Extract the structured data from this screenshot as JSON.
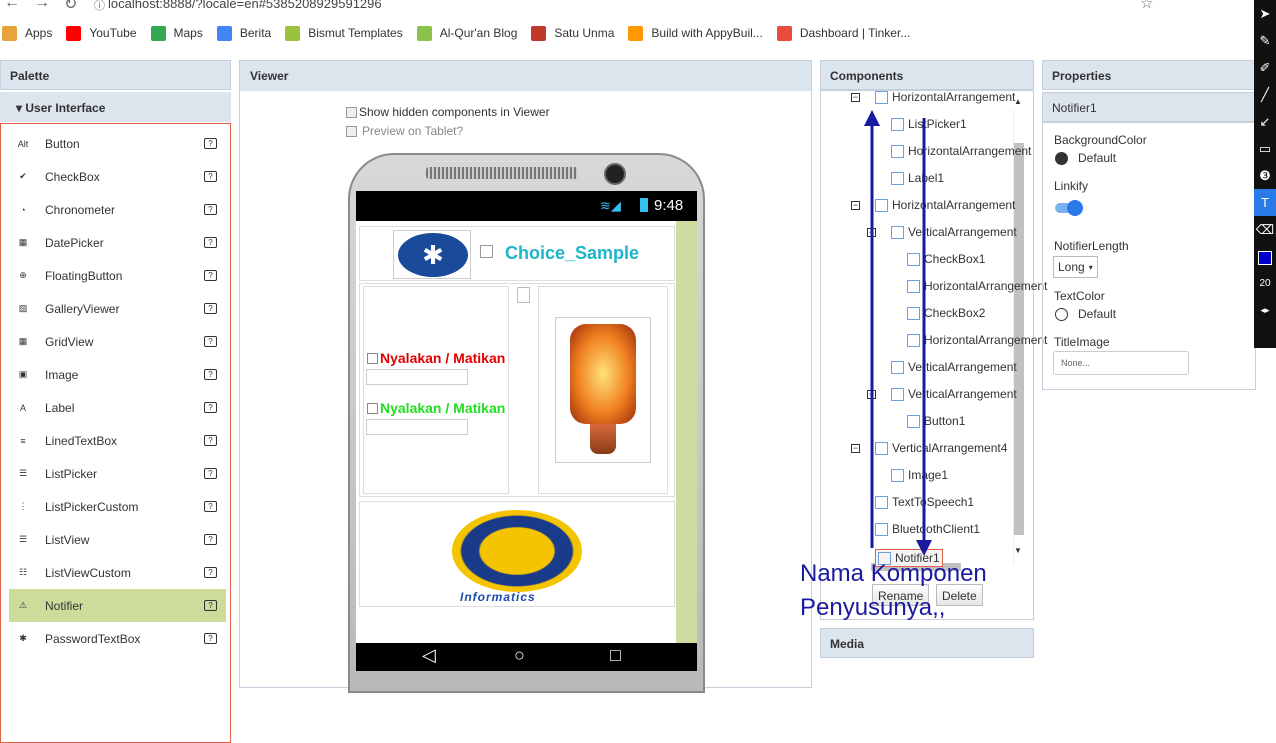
{
  "browser": {
    "url": "localhost:8888/?locale=en#5385208929591296",
    "bookmarks": [
      "Apps",
      "YouTube",
      "Maps",
      "Berita",
      "Bismut Templates",
      "Al-Qur'an Blog",
      "Satu Unma",
      "Build with AppyBuil...",
      "Dashboard | Tinker..."
    ],
    "bookmark_colors": [
      "#e8a33b",
      "#ff0000",
      "#34a853",
      "#4285f4",
      "#9bc23c",
      "#8bc34a",
      "#c0392b",
      "#ff9800",
      "#e74c3c"
    ]
  },
  "palette": {
    "title": "Palette",
    "section": "User Interface",
    "items": [
      {
        "label": "Button",
        "icon": "button-icon"
      },
      {
        "label": "CheckBox",
        "icon": "checkbox-icon"
      },
      {
        "label": "Chronometer",
        "icon": "chronometer-icon"
      },
      {
        "label": "DatePicker",
        "icon": "datepicker-icon"
      },
      {
        "label": "FloatingButton",
        "icon": "floating-button-icon"
      },
      {
        "label": "GalleryViewer",
        "icon": "gallery-viewer-icon"
      },
      {
        "label": "GridView",
        "icon": "grid-view-icon"
      },
      {
        "label": "Image",
        "icon": "image-icon"
      },
      {
        "label": "Label",
        "icon": "label-icon"
      },
      {
        "label": "LinedTextBox",
        "icon": "lined-textbox-icon"
      },
      {
        "label": "ListPicker",
        "icon": "listpicker-icon"
      },
      {
        "label": "ListPickerCustom",
        "icon": "listpicker-custom-icon"
      },
      {
        "label": "ListView",
        "icon": "listview-icon"
      },
      {
        "label": "ListViewCustom",
        "icon": "listview-custom-icon"
      },
      {
        "label": "Notifier",
        "icon": "notifier-icon",
        "selected": true
      },
      {
        "label": "PasswordTextBox",
        "icon": "password-icon"
      }
    ]
  },
  "viewer": {
    "title": "Viewer",
    "show_hidden": "Show hidden components in Viewer",
    "preview_tablet": "Preview on Tablet?",
    "status_time": "9:48",
    "app_title": "Choice_Sample",
    "checkbox_red": "Nyalakan / Matikan",
    "checkbox_green": "Nyalakan / Matikan",
    "logo_caption": "Informatics",
    "colors": {
      "red": "#e00000",
      "green": "#22dd22",
      "title": "#1db5c8",
      "sidebar": "#cfdca0"
    }
  },
  "components": {
    "title": "Components",
    "nodes": [
      {
        "label": "HorizontalArrangement",
        "indent": 1
      },
      {
        "label": "ListPicker1",
        "indent": 2
      },
      {
        "label": "HorizontalArrangement",
        "indent": 2
      },
      {
        "label": "Label1",
        "indent": 2
      },
      {
        "label": "HorizontalArrangement",
        "indent": 1
      },
      {
        "label": "VerticalArrangement",
        "indent": 2
      },
      {
        "label": "CheckBox1",
        "indent": 3
      },
      {
        "label": "HorizontalArrangement",
        "indent": 3
      },
      {
        "label": "CheckBox2",
        "indent": 3
      },
      {
        "label": "HorizontalArrangement",
        "indent": 3
      },
      {
        "label": "VerticalArrangement",
        "indent": 2
      },
      {
        "label": "VerticalArrangement",
        "indent": 2
      },
      {
        "label": "Button1",
        "indent": 3
      },
      {
        "label": "VerticalArrangement4",
        "indent": 1
      },
      {
        "label": "Image1",
        "indent": 2
      },
      {
        "label": "TextToSpeech1",
        "indent": 1
      },
      {
        "label": "BluetoothClient1",
        "indent": 1
      },
      {
        "label": "Notifier1",
        "indent": 1
      }
    ],
    "rename": "Rename",
    "delete": "Delete",
    "media_title": "Media"
  },
  "annotation": {
    "line1": "Nama Komponen",
    "line2": "Penyusunya,,",
    "color": "#1a1aa0"
  },
  "properties": {
    "title": "Properties",
    "component": "Notifier1",
    "background_color_label": "BackgroundColor",
    "background_color_value": "Default",
    "linkify_label": "Linkify",
    "notifier_length_label": "NotifierLength",
    "notifier_length_value": "Long",
    "text_color_label": "TextColor",
    "text_color_value": "Default",
    "title_image_label": "TitleImage",
    "title_image_value": "None..."
  },
  "drawing_toolbar": {
    "size": "20",
    "selected_color": "#0000cc"
  }
}
